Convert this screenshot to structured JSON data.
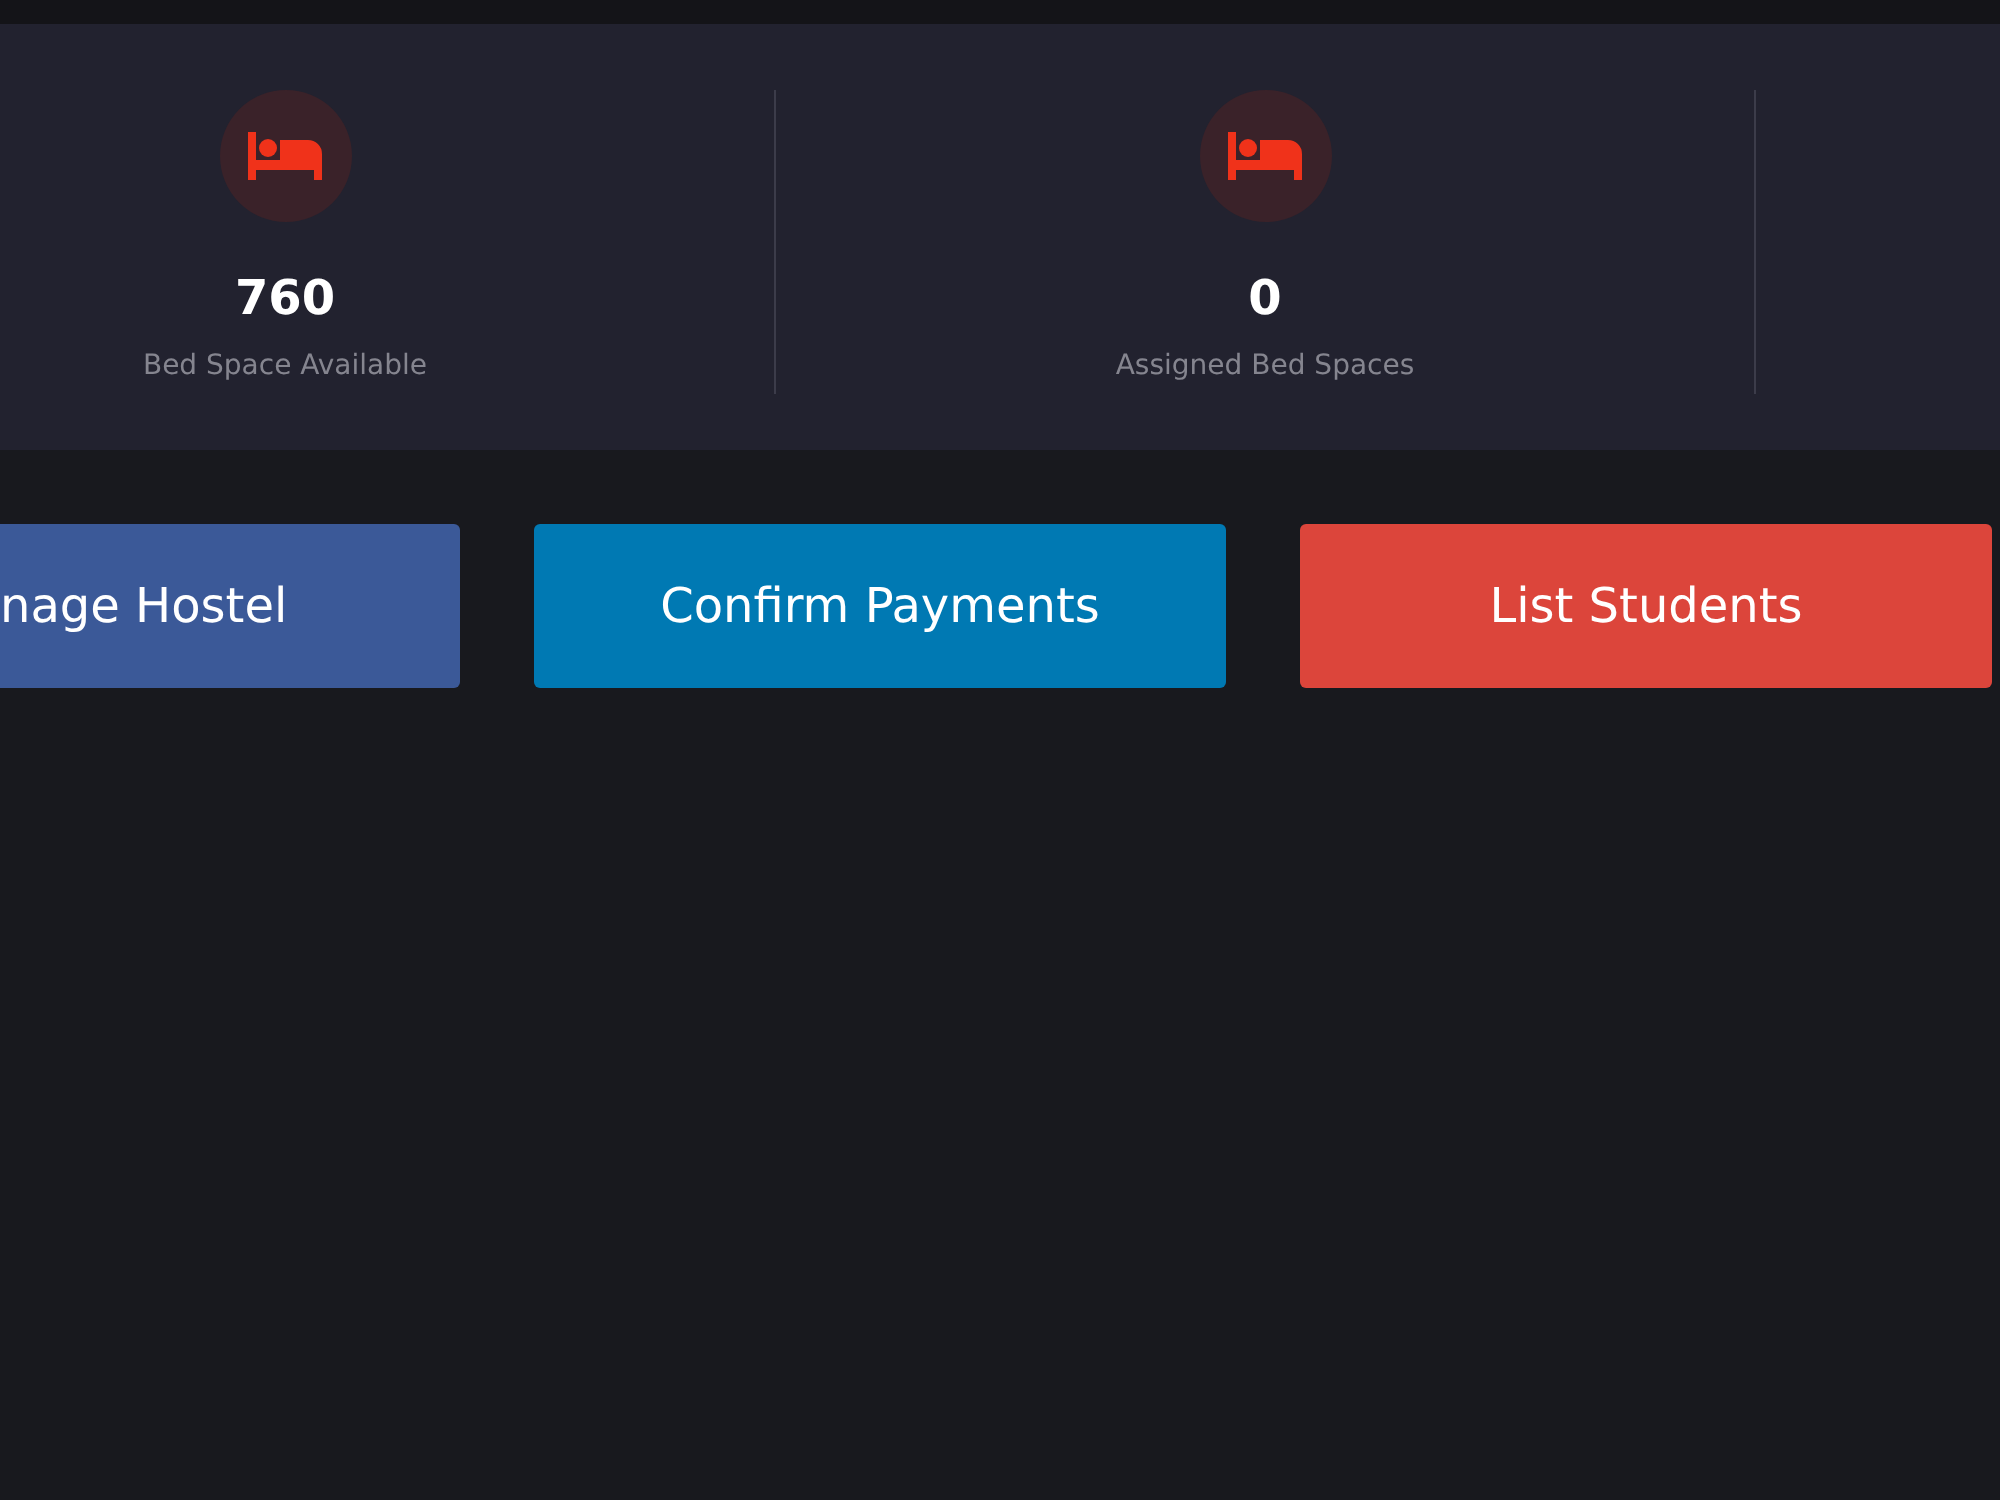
{
  "stats": [
    {
      "value": "760",
      "label": "Bed Space Available"
    },
    {
      "value": "0",
      "label": "Assigned Bed Spaces"
    }
  ],
  "buttons": [
    {
      "label": "nage Hostel",
      "color": "#3b5998",
      "cut": true
    },
    {
      "label": "Confirm Payments",
      "color": "#0079b3",
      "cut": false
    },
    {
      "label": "List Students",
      "color": "#dc453b",
      "cut": false
    }
  ]
}
